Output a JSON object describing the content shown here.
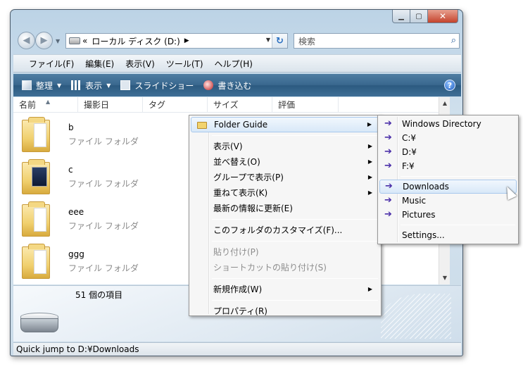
{
  "address": {
    "prefix": "«",
    "location": "ローカル ディスク (D:)",
    "separator": "▶"
  },
  "search": {
    "placeholder": "検索"
  },
  "menubar": {
    "items": [
      "ファイル(F)",
      "編集(E)",
      "表示(V)",
      "ツール(T)",
      "ヘルプ(H)"
    ]
  },
  "toolbar": {
    "organize": "整理",
    "view": "表示",
    "slideshow": "スライドショー",
    "burn": "書き込む"
  },
  "columns": [
    "名前",
    "撮影日",
    "タグ",
    "サイズ",
    "評価"
  ],
  "files": [
    {
      "name": "b",
      "type": "ファイル フォルダ"
    },
    {
      "name": "c",
      "type": "ファイル フォルダ"
    },
    {
      "name": "eee",
      "type": "ファイル フォルダ"
    },
    {
      "name": "ggg",
      "type": "ファイル フォルダ"
    }
  ],
  "details": {
    "count": "51 個の項目"
  },
  "status": {
    "text": "Quick jump to D:¥Downloads"
  },
  "context_menu": {
    "folder_guide": "Folder Guide",
    "view": "表示(V)",
    "sort": "並べ替え(O)",
    "group": "グループで表示(P)",
    "stack": "重ねて表示(K)",
    "refresh": "最新の情報に更新(E)",
    "customize": "このフォルダのカスタマイズ(F)...",
    "paste": "貼り付け(P)",
    "paste_shortcut": "ショートカットの貼り付け(S)",
    "new": "新規作成(W)",
    "properties": "プロパティ(R)"
  },
  "submenu": {
    "windows_dir": "Windows Directory",
    "c": "C:¥",
    "d": "D:¥",
    "f": "F:¥",
    "downloads": "Downloads",
    "music": "Music",
    "pictures": "Pictures",
    "settings": "Settings..."
  }
}
